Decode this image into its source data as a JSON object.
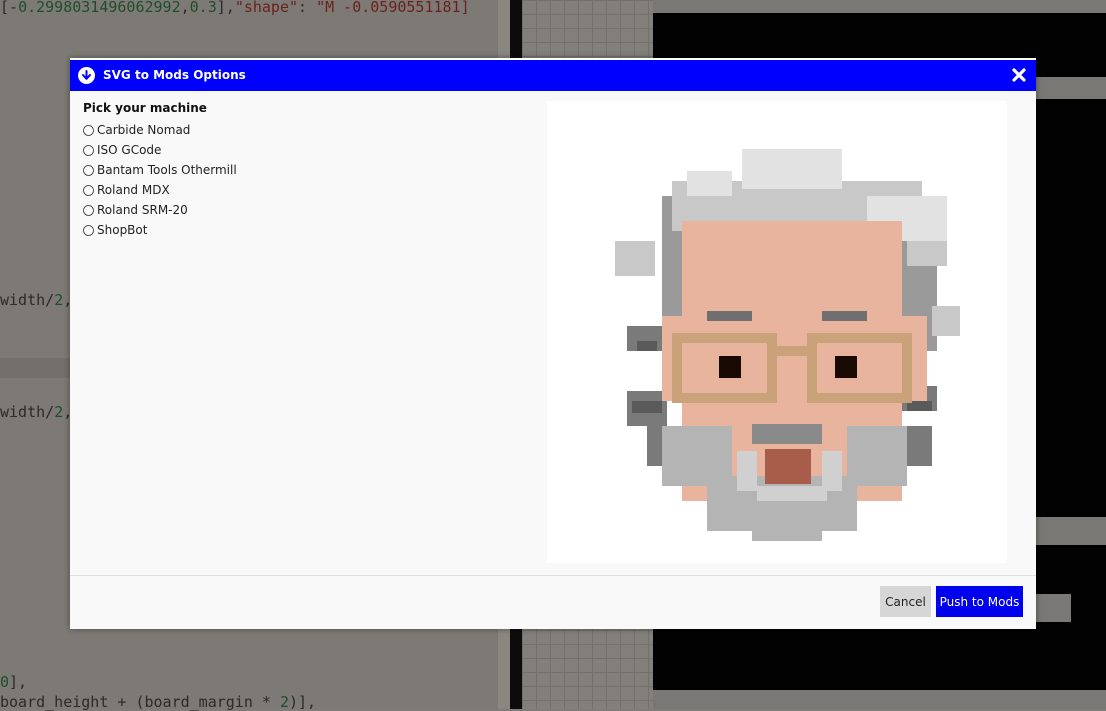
{
  "background": {
    "code_lines": [
      {
        "prefix": "[-",
        "num1": "0.2998031496062992",
        "mid": ",",
        "num2": "0.3",
        "tail": "],",
        "str1": "\"shape\"",
        "colon": ": ",
        "str2": "\"M -0.0590551181]"
      },
      {
        "text_a": "width/",
        "num": "2",
        "text_b": ","
      },
      {
        "text_a": "width/",
        "num": "2",
        "text_b": ","
      },
      {
        "num": "0",
        "text_b": "],"
      },
      {
        "text_a": "board_height + (board_margin * ",
        "num": "2",
        "text_b": ")],"
      }
    ]
  },
  "modal": {
    "title": "SVG to Mods Options",
    "header_icon": "arrow-down-circle-icon",
    "close_icon": "close-icon",
    "section_title": "Pick your machine",
    "machines": [
      {
        "label": "Carbide Nomad",
        "selected": false
      },
      {
        "label": "ISO GCode",
        "selected": false
      },
      {
        "label": "Bantam Tools Othermill",
        "selected": false
      },
      {
        "label": "Roland MDX",
        "selected": false
      },
      {
        "label": "Roland SRM-20",
        "selected": false
      },
      {
        "label": "ShopBot",
        "selected": false
      }
    ],
    "preview": {
      "content": "pixel-art-portrait"
    },
    "buttons": {
      "cancel": "Cancel",
      "push": "Push to Mods"
    }
  },
  "colors": {
    "header": "#0000ff",
    "primary_button": "#0000ee",
    "cancel_button": "#d6d6d6"
  }
}
